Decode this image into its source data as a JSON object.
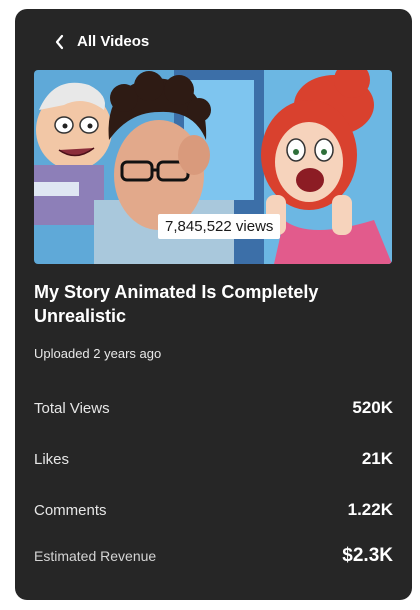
{
  "nav": {
    "back_label": "All Videos",
    "back_icon": "chevron-left-icon"
  },
  "video": {
    "thumbnail_alt": "video-thumbnail",
    "views_overlay": "7,845,522 views",
    "title": "My Story Animated Is Completely Unrealistic",
    "uploaded": "Uploaded 2 years ago"
  },
  "stats": [
    {
      "label": "Total Views",
      "value": "520K"
    },
    {
      "label": "Likes",
      "value": "21K"
    },
    {
      "label": "Comments",
      "value": "1.22K"
    },
    {
      "label": "Estimated Revenue",
      "value": "$2.3K"
    }
  ],
  "colors": {
    "card_background": "#262626",
    "text_primary": "#ffffff",
    "page_background": "#ffffff"
  }
}
